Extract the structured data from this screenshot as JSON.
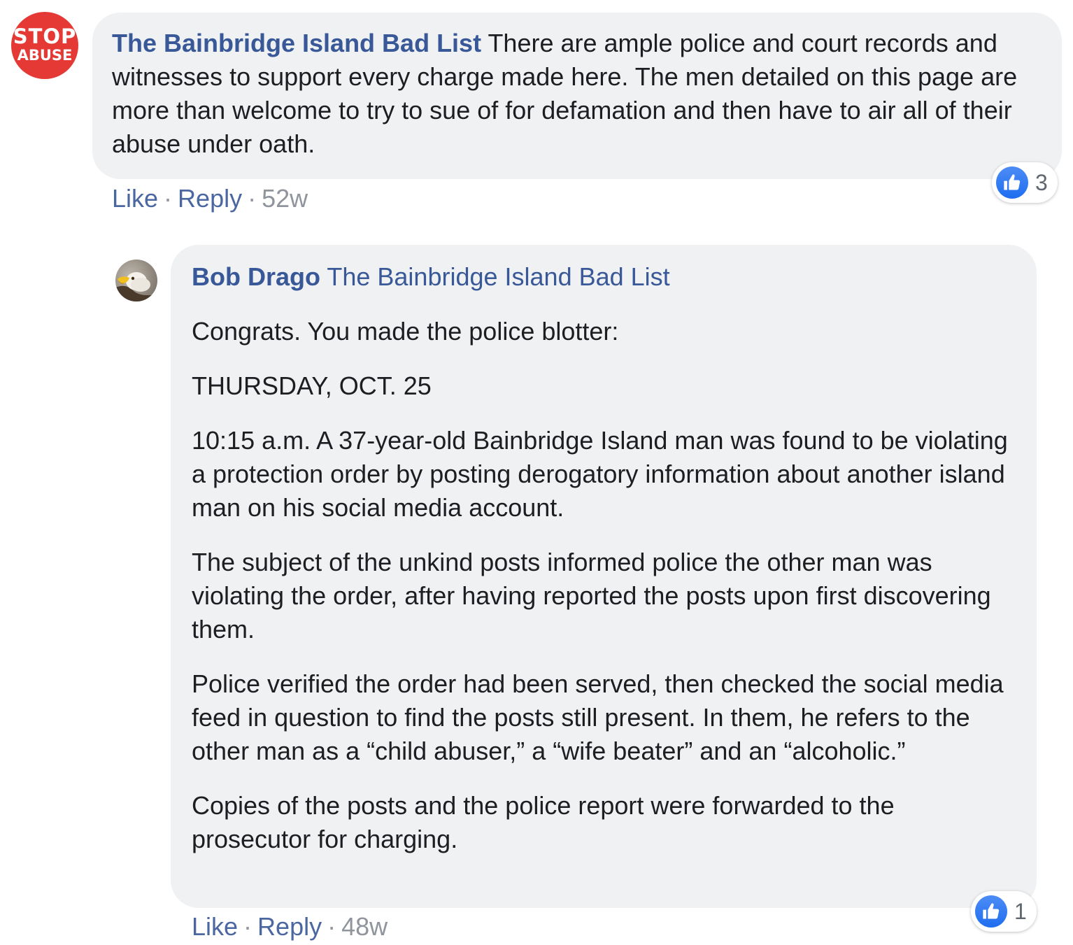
{
  "comments": [
    {
      "author": "The Bainbridge Island Bad List",
      "avatar": {
        "icon": "stop-abuse-logo",
        "line1": "STOP",
        "line2": "ABUSE",
        "color": "#e53935"
      },
      "text": "There are ample police and court records and witnesses to support every charge made here. The men detailed on this page are more than welcome to try to sue of for defamation and then have to air all of their abuse under oath.",
      "actions": {
        "like": "Like",
        "reply": "Reply",
        "time": "52w",
        "separator": "·"
      },
      "reactions": {
        "icon": "thumbs-up-icon",
        "count": "3"
      }
    },
    {
      "author": "Bob Drago",
      "avatar": {
        "icon": "eagle-avatar"
      },
      "tagged": "The Bainbridge Island Bad List",
      "paragraphs": [
        "Congrats. You made the police blotter:",
        "THURSDAY, OCT. 25",
        "10:15 a.m. A 37-year-old Bainbridge Island man was found to be violating a protection order by posting derogatory information about another island man on his social media account.",
        "The subject of the unkind posts informed police the other man was violating the order, after having reported the posts upon first discovering them.",
        "Police verified the order had been served, then checked the social media feed in question to find the posts still present. In them, he refers to the other man as a “child abuser,” a “wife beater” and an “alcoholic.”",
        "Copies of the posts and the police report were forwarded to the prosecutor for charging."
      ],
      "actions": {
        "like": "Like",
        "reply": "Reply",
        "time": "48w",
        "separator": "·"
      },
      "reactions": {
        "icon": "thumbs-up-icon",
        "count": "1"
      }
    }
  ],
  "colors": {
    "bubble": "#f0f1f3",
    "author": "#385898",
    "text": "#1c1e21",
    "meta": "#90949c",
    "like": "#1f6ef0"
  }
}
